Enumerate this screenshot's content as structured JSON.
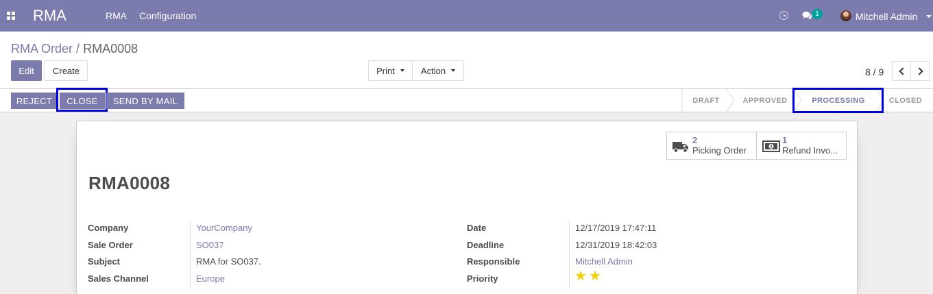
{
  "navbar": {
    "brand": "RMA",
    "menu": [
      "RMA",
      "Configuration"
    ],
    "chat_badge": "1",
    "user": "Mitchell Admin",
    "icons": [
      "apps-icon",
      "clock-icon",
      "chat-icon",
      "avatar"
    ]
  },
  "control_panel": {
    "breadcrumb_parent": "RMA Order",
    "breadcrumb_sep": "/",
    "breadcrumb_current": "RMA0008",
    "edit_label": "Edit",
    "create_label": "Create",
    "print_label": "Print",
    "action_label": "Action",
    "pager": "8 / 9"
  },
  "statusbar": {
    "buttons": [
      "REJECT",
      "CLOSE",
      "SEND BY MAIL"
    ],
    "stages": [
      "DRAFT",
      "APPROVED",
      "PROCESSING",
      "CLOSED"
    ],
    "current_stage": "PROCESSING"
  },
  "smart_buttons": [
    {
      "count": "2",
      "label": "Picking Order",
      "icon": "truck-icon"
    },
    {
      "count": "1",
      "label": "Refund Invo...",
      "icon": "money-icon"
    }
  ],
  "form": {
    "title": "RMA0008",
    "left_fields": [
      {
        "label": "Company",
        "value": "YourCompany"
      },
      {
        "label": "Sale Order",
        "value": "SO037"
      },
      {
        "label": "Subject",
        "value": "RMA for SO037."
      },
      {
        "label": "Sales Channel",
        "value": "Europe"
      }
    ],
    "right_fields": [
      {
        "label": "Date",
        "value": "12/17/2019 17:47:11"
      },
      {
        "label": "Deadline",
        "value": "12/31/2019 18:42:03"
      },
      {
        "label": "Responsible",
        "value": "Mitchell Admin"
      },
      {
        "label": "Priority",
        "value": 2
      }
    ],
    "priority_stars": "2 of 2"
  },
  "colors": {
    "brand": "#7c7bad",
    "highlight": "#0000e6",
    "star": "#f3cc00",
    "badge": "#00a09d"
  }
}
